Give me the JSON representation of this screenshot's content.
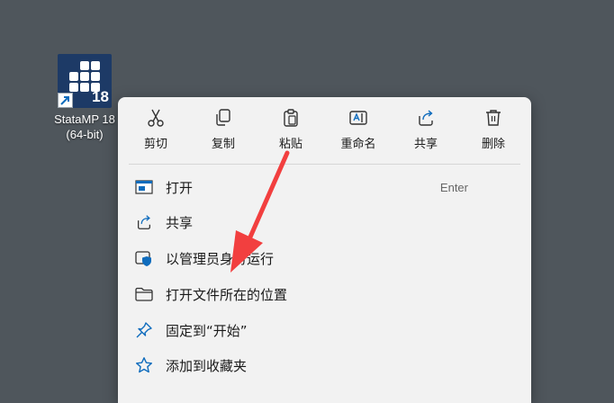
{
  "desktop": {
    "app_name_line1": "StataMP 18",
    "app_name_line2": "(64-bit)",
    "tile_badge": "18",
    "background_color": "#4f565c",
    "tile_color": "#1d3a66"
  },
  "context_menu": {
    "toolbar": [
      {
        "id": "cut",
        "label": "剪切",
        "icon": "scissors-icon"
      },
      {
        "id": "copy",
        "label": "复制",
        "icon": "copy-icon"
      },
      {
        "id": "paste",
        "label": "粘贴",
        "icon": "clipboard-icon"
      },
      {
        "id": "rename",
        "label": "重命名",
        "icon": "rename-icon"
      },
      {
        "id": "share",
        "label": "共享",
        "icon": "share-icon"
      },
      {
        "id": "delete",
        "label": "删除",
        "icon": "trash-icon"
      }
    ],
    "items": [
      {
        "id": "open",
        "label": "打开",
        "shortcut": "Enter",
        "icon": "window-icon"
      },
      {
        "id": "share",
        "label": "共享",
        "icon": "share-icon"
      },
      {
        "id": "run-as-admin",
        "label": "以管理员身份运行",
        "icon": "shield-icon"
      },
      {
        "id": "open-file-location",
        "label": "打开文件所在的位置",
        "icon": "folder-icon"
      },
      {
        "id": "pin-to-start",
        "label": "固定到“开始”",
        "icon": "pin-icon"
      },
      {
        "id": "add-to-favorites",
        "label": "添加到收藏夹",
        "icon": "star-icon"
      }
    ],
    "accent_color": "#0f6cbd",
    "annotation_arrow_color": "#f23f3f"
  }
}
